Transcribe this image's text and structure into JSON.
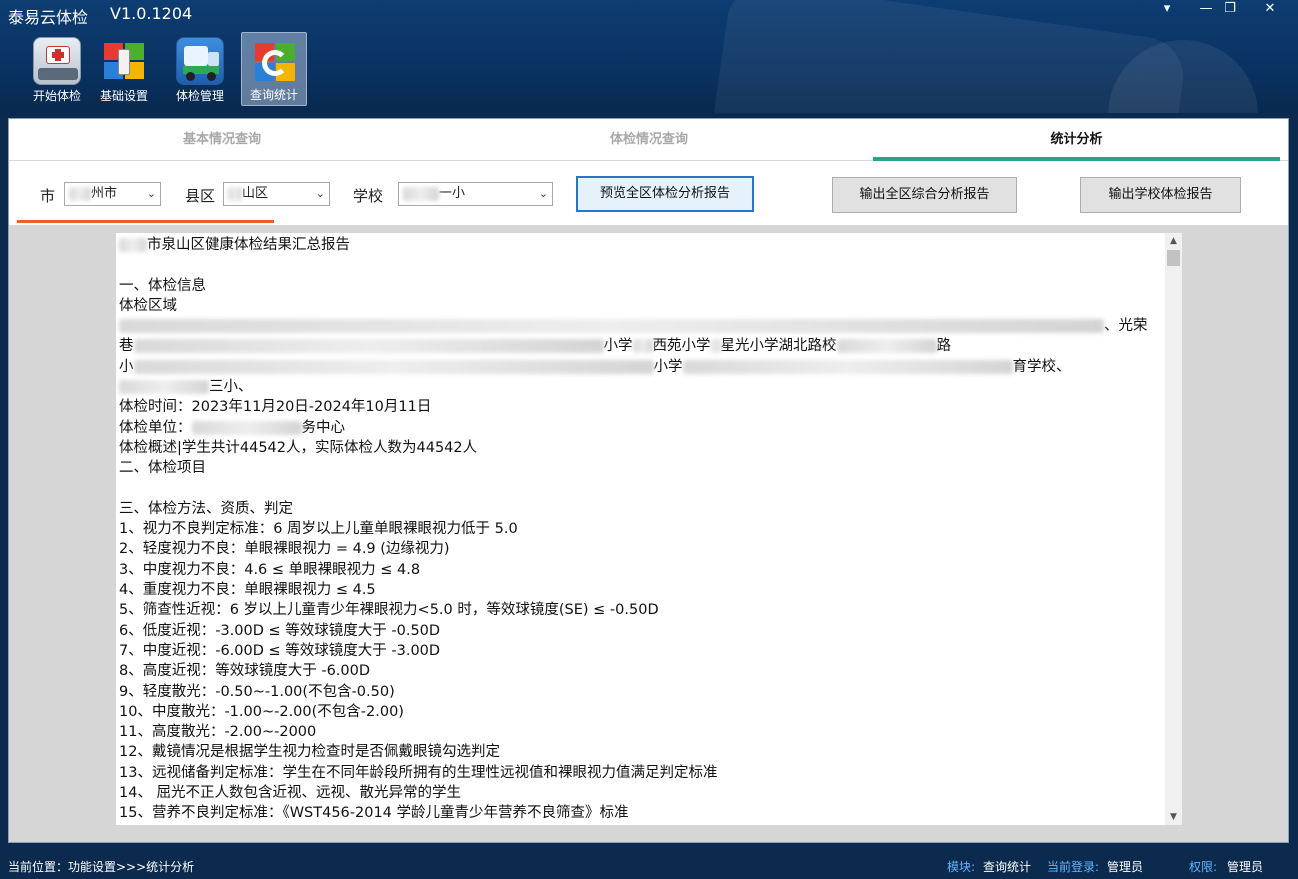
{
  "app": {
    "title": "泰易云体检",
    "version": "V1.0.1204"
  },
  "window_controls": [
    "▾",
    "—",
    "❐",
    "✕"
  ],
  "toolbar": [
    {
      "label": "开始体检",
      "icon": "medical-kit-icon"
    },
    {
      "label": "基础设置",
      "icon": "windows-usb-icon"
    },
    {
      "label": "体检管理",
      "icon": "truck-icon"
    },
    {
      "label": "查询统计",
      "icon": "refresh-windows-icon"
    }
  ],
  "tabs": [
    {
      "label": "基本情况查询",
      "active": false
    },
    {
      "label": "体检情况查询",
      "active": false
    },
    {
      "label": "统计分析",
      "active": true
    }
  ],
  "filters": {
    "city_label": "市",
    "city_value": "州市",
    "district_label": "县区",
    "district_value": "山区",
    "school_label": "学校",
    "school_value": "一小"
  },
  "buttons": {
    "preview": "预览全区体检分析报告",
    "export_district": "输出全区综合分析报告",
    "export_school": "输出学校体检报告"
  },
  "report": {
    "lines": [
      "市泉山区健康体检结果汇总报告",
      "",
      "一、体检信息",
      "体检区域",
      "",
      "",
      "",
      "",
      "体检时间：2023年11月20日-2024年10月11日",
      "体检单位：",
      "体检概述|学生共计44542人，实际体检人数为44542人",
      "二、体检项目",
      "",
      "三、体检方法、资质、判定",
      "1、视力不良判定标准：6 周岁以上儿童单眼裸眼视力低于 5.0",
      "2、轻度视力不良：单眼裸眼视力 = 4.9 (边缘视力)",
      "3、中度视力不良：4.6 ≤ 单眼裸眼视力 ≤ 4.8",
      "4、重度视力不良：单眼裸眼视力 ≤ 4.5",
      "5、筛查性近视：6 岁以上儿童青少年裸眼视力<5.0 时，等效球镜度(SE)  ≤ -0.50D",
      "6、低度近视：-3.00D ≤ 等效球镜度大于 -0.50D",
      "7、中度近视：-6.00D ≤ 等效球镜度大于 -3.00D",
      "8、高度近视：等效球镜度大于 -6.00D",
      "9、轻度散光：-0.50~-1.00(不包含-0.50)",
      "10、中度散光：-1.00~-2.00(不包含-2.00)",
      "11、高度散光：-2.00~-2000",
      "12、戴镜情况是根据学生视力检查时是否佩戴眼镜勾选判定",
      "13、远视储备判定标准：学生在不同年龄段所拥有的生理性远视值和裸眼视力值满足判定标准",
      "14、 屈光不正人数包含近视、远视、散光异常的学生",
      "15、营养不良判定标准：《WST456-2014 学龄儿童青少年营养不良筛查》标准"
    ],
    "partial": {
      "region_1_end": "、光荣",
      "region_2_a": "巷",
      "region_2_b": "小学",
      "region_2_c": "西苑小学",
      "region_2_d": "星光小学湖北路校",
      "region_2_end": "路",
      "region_3_a": "小",
      "region_3_b": "小学",
      "region_3_c": "育学校、",
      "region_4_end": "三小、",
      "unit_end": "务中心"
    }
  },
  "status": {
    "location_label": "当前位置：",
    "location_value": "功能设置>>>统计分析",
    "module_label": "模块:",
    "module_value": "查询统计",
    "login_label": "当前登录:",
    "login_value": "管理员",
    "role_label": "权限:",
    "role_value": "管理员"
  }
}
